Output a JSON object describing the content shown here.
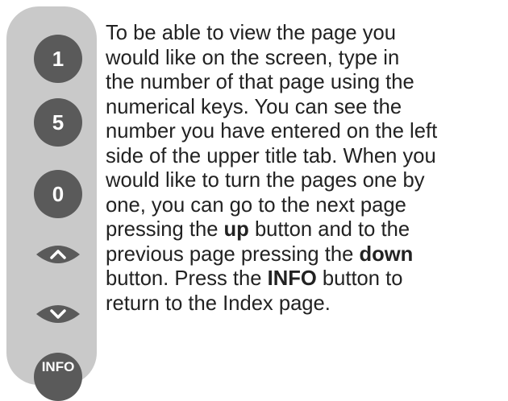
{
  "remote": {
    "key_1": "1",
    "key_5": "5",
    "key_0": "0",
    "key_info": "INFO",
    "up_icon": "chevron-up-icon",
    "down_icon": "chevron-down-icon",
    "key_color": "#5a5a5a",
    "panel_color": "#c9c9c9"
  },
  "description": {
    "line_1": "To be able to view the page you",
    "line_2": "would like on the screen, type in",
    "line_3": "the number of that page using the",
    "line_4": "numerical keys. You can see the",
    "line_5": "number you have entered on the left",
    "line_6": "side of the upper title tab. When you",
    "line_7": "would like to turn the pages one by",
    "line_8": "one, you can go to the next page",
    "line_9_a": "pressing the ",
    "line_9_b": "up",
    "line_9_c": " button and to the",
    "line_10_a": "previous page pressing the ",
    "line_10_b": "down",
    "line_11_a": "button. Press the ",
    "line_11_b": "INFO",
    "line_11_c": " button to",
    "line_12": "return to the Index page."
  }
}
